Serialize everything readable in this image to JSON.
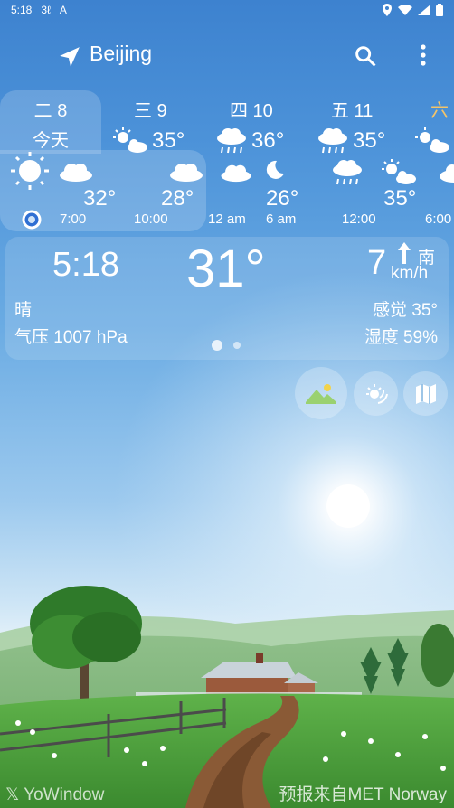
{
  "status_bar": {
    "time": "5:18",
    "icon1": "3ℓ",
    "icon2": "A"
  },
  "app_bar": {
    "city": "Beijing"
  },
  "days": [
    {
      "name": "二 8",
      "sub": "今天"
    },
    {
      "name": "三 9",
      "temp": "35°"
    },
    {
      "name": "四 10",
      "temp": "36°"
    },
    {
      "name": "五 11",
      "temp": "35°"
    },
    {
      "name": "六"
    }
  ],
  "hourly": [
    {
      "temp": "32°",
      "time": "7:00"
    },
    {
      "temp": "28°",
      "time": "10:00"
    },
    {
      "temp": "",
      "time": "12 am"
    },
    {
      "temp": "26°",
      "time": "6 am"
    },
    {
      "temp": "",
      "time": "12:00"
    },
    {
      "temp": "35°",
      "time": "6:00"
    }
  ],
  "current": {
    "time": "5:18",
    "temp": "31°",
    "wind_speed": "7",
    "wind_dir": "南",
    "wind_unit": "km/h",
    "condition": "晴",
    "pressure": "气压 1007 hPa",
    "feels_like": "感觉 35°",
    "humidity": "湿度 59%"
  },
  "footer": {
    "brand": "YoWindow",
    "source": "预报来自MET Norway"
  },
  "colors": {
    "sky_top": "#3d82cf",
    "sun_blue": "#2f6fd3",
    "grass": "#3f9a3c"
  }
}
